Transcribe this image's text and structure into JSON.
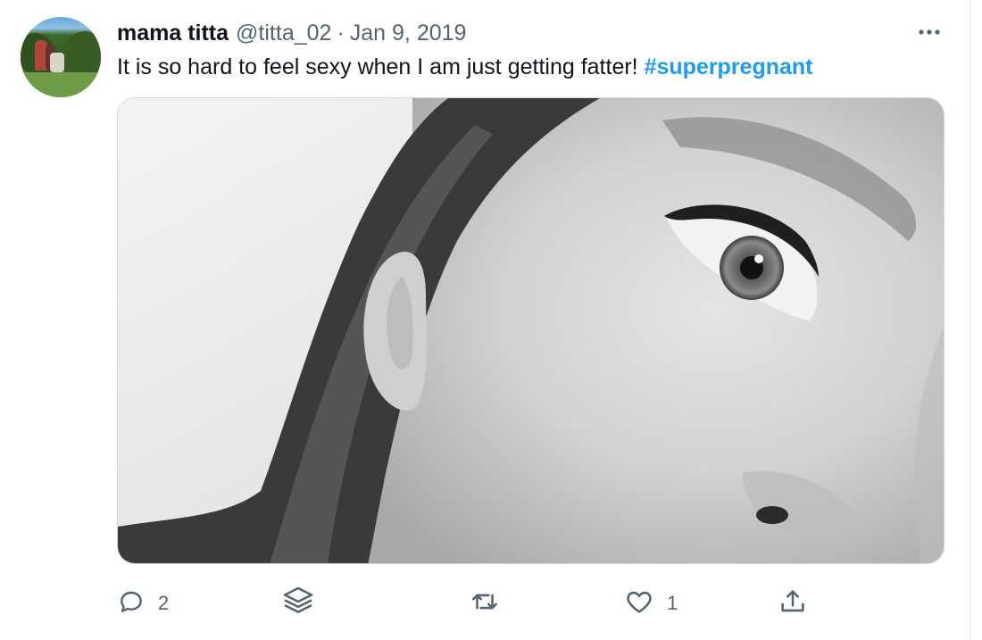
{
  "tweet": {
    "display_name": "mama titta",
    "handle": "@titta_02",
    "separator": "·",
    "date": "Jan 9, 2019",
    "text": "It is so hard to feel sexy when I am just getting fatter!",
    "hashtag": "#superpregnant",
    "more_icon": "more-horizontal-icon",
    "avatar_icon": "profile-avatar",
    "media_description_icon": "photo-grayscale-face"
  },
  "actions": {
    "reply": {
      "icon": "reply-icon",
      "count": "2"
    },
    "stack": {
      "icon": "layers-icon"
    },
    "retweet": {
      "icon": "retweet-icon"
    },
    "like": {
      "icon": "heart-icon",
      "count": "1"
    },
    "share": {
      "icon": "share-icon"
    }
  },
  "colors": {
    "accent": "#1d9bf0",
    "secondary_text": "#536471",
    "primary_text": "#0f1419",
    "border": "#cfd9de"
  }
}
